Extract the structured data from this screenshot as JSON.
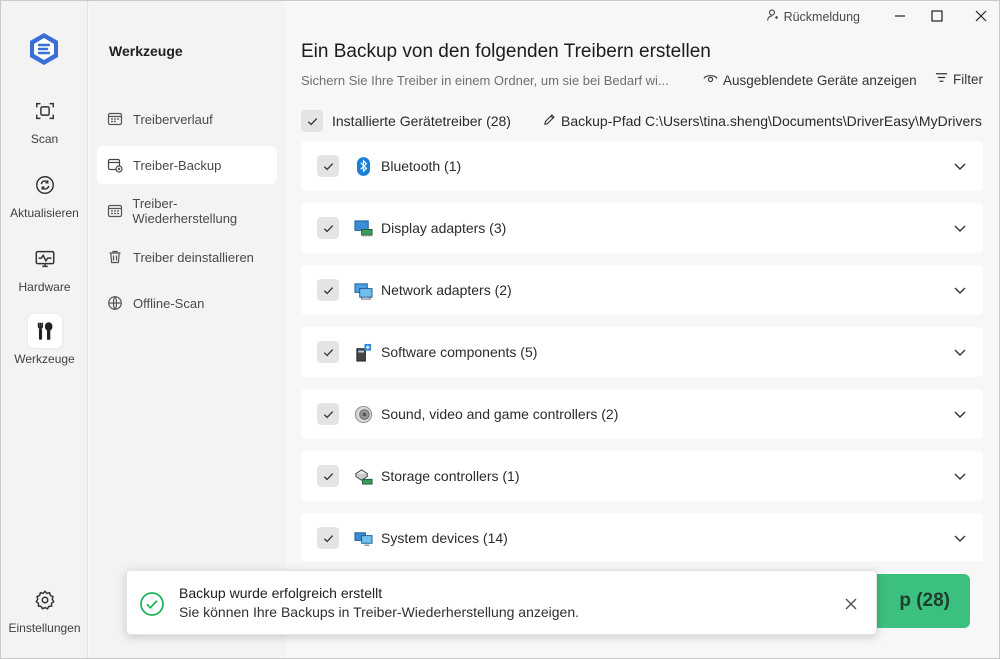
{
  "colors": {
    "accent": "#3cc07f",
    "brand_blue": "#3a6fd8",
    "success": "#22b35e"
  },
  "rail": {
    "items": [
      {
        "label": "Scan",
        "icon": "scan-icon"
      },
      {
        "label": "Aktualisieren",
        "icon": "refresh-icon"
      },
      {
        "label": "Hardware",
        "icon": "monitor-pulse-icon"
      },
      {
        "label": "Werkzeuge",
        "icon": "tools-icon",
        "active": true
      }
    ],
    "settings_label": "Einstellungen"
  },
  "side": {
    "title": "Werkzeuge",
    "items": [
      {
        "label": "Treiberverlauf",
        "icon": "history-icon"
      },
      {
        "label": "Treiber-Backup",
        "icon": "backup-icon",
        "active": true
      },
      {
        "label": "Treiber-Wiederherstellung",
        "icon": "restore-icon"
      },
      {
        "label": "Treiber deinstallieren",
        "icon": "trash-icon"
      },
      {
        "label": "Offline-Scan",
        "icon": "globe-icon"
      }
    ]
  },
  "topbar": {
    "feedback": "Rückmeldung"
  },
  "main": {
    "title": "Ein Backup von den folgenden Treibern erstellen",
    "subtitle": "Sichern Sie Ihre Treiber in einem Ordner, um sie bei Bedarf wi...",
    "hidden_devices": "Ausgeblendete Geräte anzeigen",
    "filter": "Filter",
    "installed": "Installierte Gerätetreiber (28)",
    "path": "Backup-Pfad C:\\Users\\tina.sheng\\Documents\\DriverEasy\\MyDrivers",
    "categories": [
      {
        "label": "Bluetooth (1)",
        "icon": "bluetooth-icon",
        "checked": true
      },
      {
        "label": "Display adapters (3)",
        "icon": "display-adapter-icon",
        "checked": true
      },
      {
        "label": "Network adapters (2)",
        "icon": "network-adapter-icon",
        "checked": true
      },
      {
        "label": "Software components (5)",
        "icon": "software-component-icon",
        "checked": true
      },
      {
        "label": "Sound, video and game controllers (2)",
        "icon": "speaker-icon",
        "checked": true
      },
      {
        "label": "Storage controllers (1)",
        "icon": "storage-controller-icon",
        "checked": true
      },
      {
        "label": "System devices (14)",
        "icon": "system-device-icon",
        "checked": true
      }
    ],
    "backup_button": "p (28)"
  },
  "toast": {
    "title": "Backup wurde erfolgreich erstellt",
    "message": "Sie können Ihre Backups in Treiber-Wiederherstellung anzeigen."
  }
}
